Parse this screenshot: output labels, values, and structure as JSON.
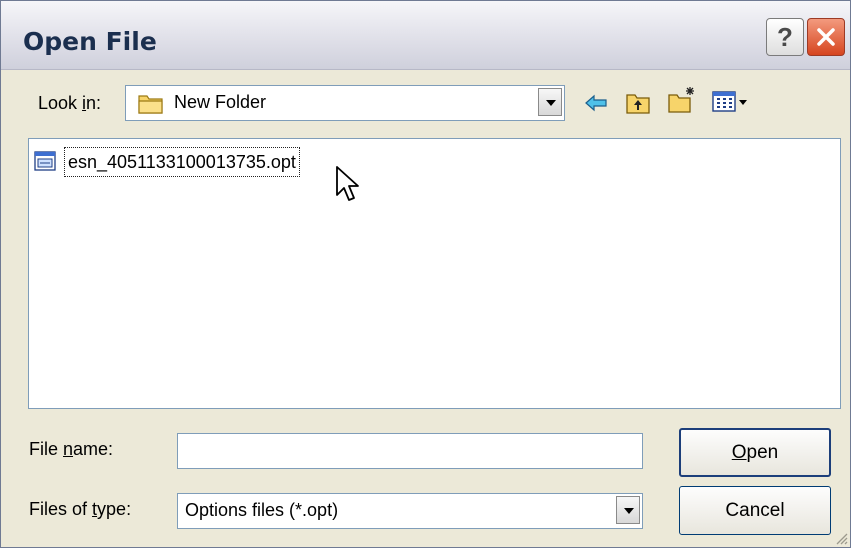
{
  "window": {
    "title": "Open File",
    "help_label": "?",
    "close_icon": "close-icon"
  },
  "look_in": {
    "label_pre": "Look ",
    "label_key": "i",
    "label_post": "n:",
    "value": "New Folder",
    "icon": "folder-icon"
  },
  "toolbar": {
    "back_icon": "back-arrow-icon",
    "up_icon": "up-folder-icon",
    "new_folder_icon": "new-folder-icon",
    "view_icon": "view-menu-icon"
  },
  "files": [
    {
      "name": "esn_4051133100013735.opt",
      "icon": "opt-file-icon",
      "focused": true
    }
  ],
  "file_name": {
    "label_pre": "File ",
    "label_key": "n",
    "label_post": "ame:",
    "value": "",
    "placeholder": ""
  },
  "file_type": {
    "label_pre": "Files of ",
    "label_key": "t",
    "label_post": "ype:",
    "value": "Options files (*.opt)"
  },
  "buttons": {
    "open_key": "O",
    "open_rest": "pen",
    "cancel": "Cancel"
  },
  "colors": {
    "dialog_bg": "#ece9d8",
    "field_border": "#7f9db9",
    "close_red": "#d6451f"
  }
}
